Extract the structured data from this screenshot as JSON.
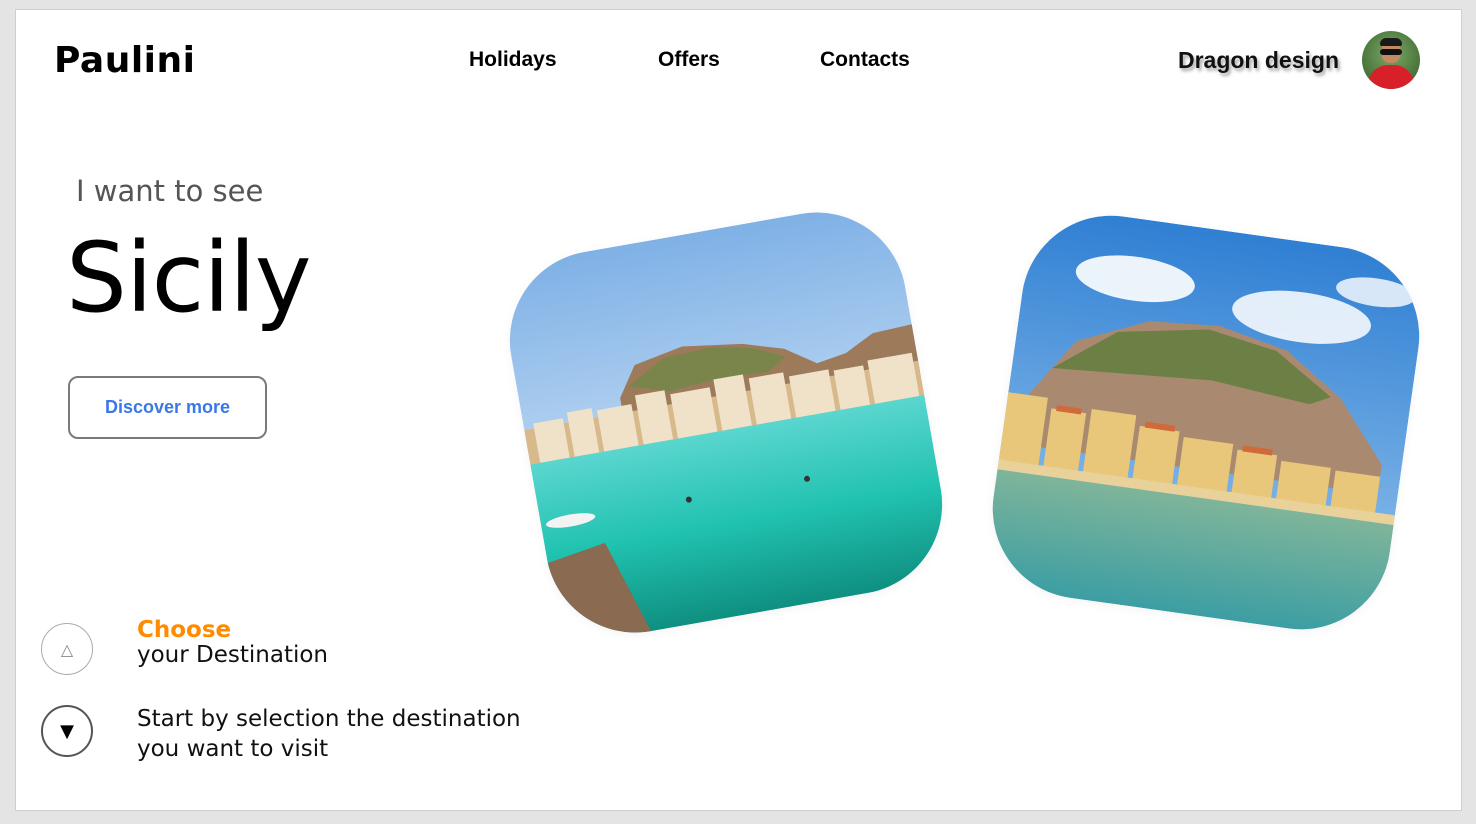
{
  "header": {
    "logo": "Paulini",
    "nav": [
      "Holidays",
      "Offers",
      "Contacts"
    ],
    "user_name": "Dragon design"
  },
  "hero": {
    "intro": "I want to see",
    "destination": "Sicily",
    "discover_label": "Discover more"
  },
  "steps": {
    "up_symbol": "△",
    "down_symbol": "▼",
    "choose_word": "Choose",
    "choose_rest": "your Destination",
    "description_line1": "Start by selection the destination",
    "description_line2": "you want to visit"
  },
  "colors": {
    "accent_orange": "#ff8c00",
    "link_blue": "#3b78e7"
  },
  "icons": {
    "up": "triangle-up-icon",
    "down": "triangle-down-icon",
    "avatar": "user-avatar"
  }
}
